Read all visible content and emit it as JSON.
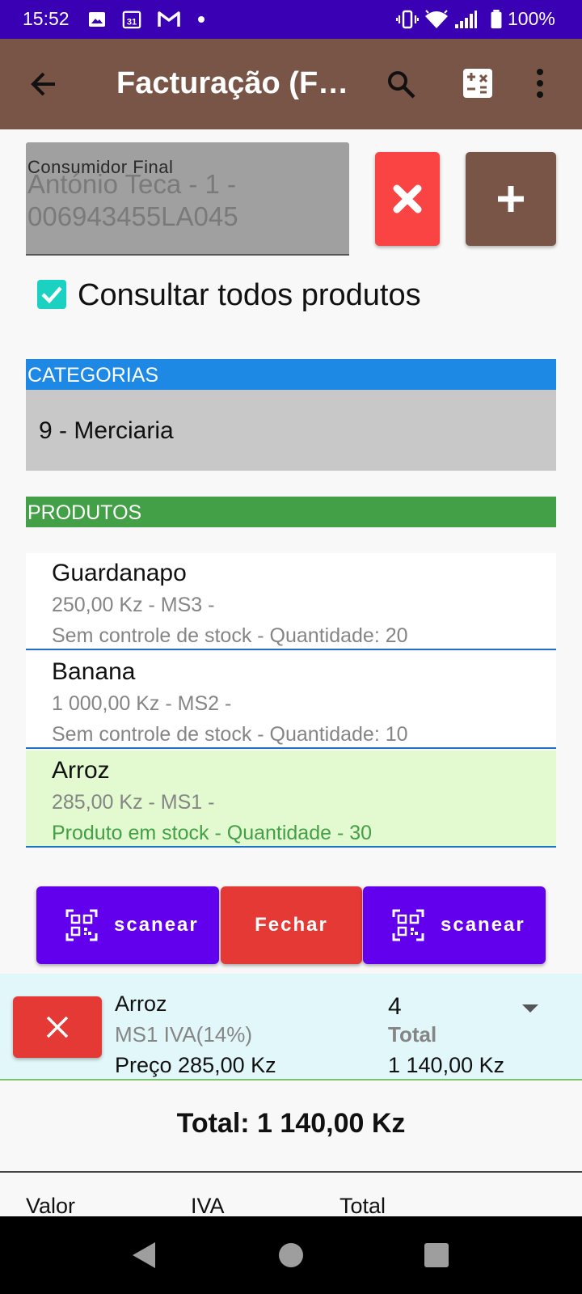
{
  "status_bar": {
    "time": "15:52",
    "battery": "100%"
  },
  "app_bar": {
    "title": "Facturação (F…"
  },
  "customer": {
    "label": "Consumidor Final",
    "value": "António Teca - 1 - 006943455LA045"
  },
  "consult_all": {
    "label": "Consultar todos produtos",
    "checked": true
  },
  "categories": {
    "header": "CATEGORIAS",
    "selected": "9 - Merciaria"
  },
  "products": {
    "header": "PRODUTOS",
    "items": [
      {
        "name": "Guardanapo",
        "price": "250,00 Kz - MS3 -",
        "stock": "Sem controle de stock - Quantidade: 20",
        "selected": false
      },
      {
        "name": "Banana",
        "price": "1 000,00 Kz - MS2 -",
        "stock": "Sem controle de stock - Quantidade: 10",
        "selected": false
      },
      {
        "name": "Arroz",
        "price": "285,00 Kz - MS1 -",
        "stock": "Produto em stock - Quantidade - 30",
        "selected": true
      }
    ]
  },
  "actions": {
    "scan_left": "scanear",
    "close": "Fechar",
    "scan_right": "scanear"
  },
  "cart_line": {
    "name": "Arroz",
    "tax": "MS1 IVA(14%)",
    "price": "Preço 285,00 Kz",
    "quantity": "4",
    "total_label": "Total",
    "total": "1 140,00 Kz"
  },
  "grand_total": "Total: 1 140,00 Kz",
  "summary_columns": {
    "value": "Valor",
    "tax": "IVA",
    "total": "Total"
  },
  "colors": {
    "status_bar": "#3a00b4",
    "app_bar": "#795548",
    "categories": "#1e88e5",
    "products": "#43a047",
    "scan": "#6200ee",
    "close": "#e53935"
  }
}
